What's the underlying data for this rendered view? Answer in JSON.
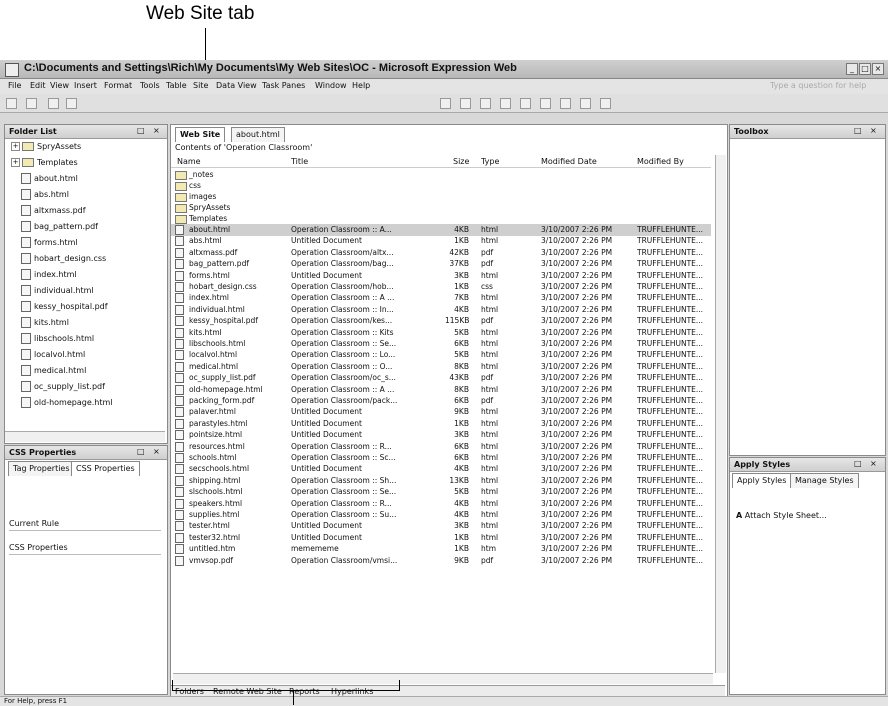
{
  "callouts": {
    "top": "Web Site tab"
  },
  "window": {
    "title": "C:\\Documents and Settings\\Rich\\My Documents\\My Web Sites\\OC - Microsoft Expression Web"
  },
  "menu": [
    "File",
    "Edit",
    "View",
    "Insert",
    "Format",
    "Tools",
    "Table",
    "Site",
    "Data View",
    "Task Panes",
    "Window",
    "Help"
  ],
  "help_box": "Type a question for help",
  "folder_list": {
    "title": "Folder List",
    "items": [
      {
        "label": "SpryAssets",
        "type": "folder",
        "expand": "+"
      },
      {
        "label": "Templates",
        "type": "folder",
        "expand": "+"
      },
      {
        "label": "about.html",
        "type": "file"
      },
      {
        "label": "abs.html",
        "type": "file"
      },
      {
        "label": "altxmass.pdf",
        "type": "file"
      },
      {
        "label": "bag_pattern.pdf",
        "type": "file"
      },
      {
        "label": "forms.html",
        "type": "file"
      },
      {
        "label": "hobart_design.css",
        "type": "file"
      },
      {
        "label": "index.html",
        "type": "file"
      },
      {
        "label": "individual.html",
        "type": "file"
      },
      {
        "label": "kessy_hospital.pdf",
        "type": "file"
      },
      {
        "label": "kits.html",
        "type": "file"
      },
      {
        "label": "libschools.html",
        "type": "file"
      },
      {
        "label": "localvol.html",
        "type": "file"
      },
      {
        "label": "medical.html",
        "type": "file"
      },
      {
        "label": "oc_supply_list.pdf",
        "type": "file"
      },
      {
        "label": "old-homepage.html",
        "type": "file"
      }
    ]
  },
  "css_properties": {
    "title": "CSS Properties",
    "tabs": [
      "Tag Properties",
      "CSS Properties"
    ],
    "current_rule_label": "Current Rule",
    "properties_label": "CSS Properties"
  },
  "editor": {
    "tabs": [
      "Web Site",
      "about.html"
    ],
    "contents_label": "Contents of 'Operation Classroom'",
    "columns": [
      "Name",
      "Title",
      "Size",
      "Type",
      "Modified Date",
      "Modified By"
    ],
    "folders": [
      "_notes",
      "css",
      "images",
      "SpryAssets",
      "Templates"
    ],
    "files": [
      {
        "name": "about.html",
        "title": "Operation Classroom :: A...",
        "size": "4KB",
        "type": "html",
        "date": "3/10/2007 2:26 PM",
        "by": "TRUFFLEHUNTE...",
        "selected": true
      },
      {
        "name": "abs.html",
        "title": "Untitled Document",
        "size": "1KB",
        "type": "html",
        "date": "3/10/2007 2:26 PM",
        "by": "TRUFFLEHUNTE..."
      },
      {
        "name": "altxmass.pdf",
        "title": "Operation Classroom/altx...",
        "size": "42KB",
        "type": "pdf",
        "date": "3/10/2007 2:26 PM",
        "by": "TRUFFLEHUNTE..."
      },
      {
        "name": "bag_pattern.pdf",
        "title": "Operation Classroom/bag...",
        "size": "37KB",
        "type": "pdf",
        "date": "3/10/2007 2:26 PM",
        "by": "TRUFFLEHUNTE..."
      },
      {
        "name": "forms.html",
        "title": "Untitled Document",
        "size": "3KB",
        "type": "html",
        "date": "3/10/2007 2:26 PM",
        "by": "TRUFFLEHUNTE..."
      },
      {
        "name": "hobart_design.css",
        "title": "Operation Classroom/hob...",
        "size": "1KB",
        "type": "css",
        "date": "3/10/2007 2:26 PM",
        "by": "TRUFFLEHUNTE..."
      },
      {
        "name": "index.html",
        "title": "Operation Classroom :: A ...",
        "size": "7KB",
        "type": "html",
        "date": "3/10/2007 2:26 PM",
        "by": "TRUFFLEHUNTE..."
      },
      {
        "name": "individual.html",
        "title": "Operation Classroom :: In...",
        "size": "4KB",
        "type": "html",
        "date": "3/10/2007 2:26 PM",
        "by": "TRUFFLEHUNTE..."
      },
      {
        "name": "kessy_hospital.pdf",
        "title": "Operation Classroom/kes...",
        "size": "115KB",
        "type": "pdf",
        "date": "3/10/2007 2:26 PM",
        "by": "TRUFFLEHUNTE..."
      },
      {
        "name": "kits.html",
        "title": "Operation Classroom :: Kits",
        "size": "5KB",
        "type": "html",
        "date": "3/10/2007 2:26 PM",
        "by": "TRUFFLEHUNTE..."
      },
      {
        "name": "libschools.html",
        "title": "Operation Classroom :: Se...",
        "size": "6KB",
        "type": "html",
        "date": "3/10/2007 2:26 PM",
        "by": "TRUFFLEHUNTE..."
      },
      {
        "name": "localvol.html",
        "title": "Operation Classroom :: Lo...",
        "size": "5KB",
        "type": "html",
        "date": "3/10/2007 2:26 PM",
        "by": "TRUFFLEHUNTE..."
      },
      {
        "name": "medical.html",
        "title": "Operation Classroom :: O...",
        "size": "8KB",
        "type": "html",
        "date": "3/10/2007 2:26 PM",
        "by": "TRUFFLEHUNTE..."
      },
      {
        "name": "oc_supply_list.pdf",
        "title": "Operation Classroom/oc_s...",
        "size": "43KB",
        "type": "pdf",
        "date": "3/10/2007 2:26 PM",
        "by": "TRUFFLEHUNTE..."
      },
      {
        "name": "old-homepage.html",
        "title": "Operation Classroom :: A ...",
        "size": "8KB",
        "type": "html",
        "date": "3/10/2007 2:26 PM",
        "by": "TRUFFLEHUNTE..."
      },
      {
        "name": "packing_form.pdf",
        "title": "Operation Classroom/pack...",
        "size": "6KB",
        "type": "pdf",
        "date": "3/10/2007 2:26 PM",
        "by": "TRUFFLEHUNTE..."
      },
      {
        "name": "palaver.html",
        "title": "Untitled Document",
        "size": "9KB",
        "type": "html",
        "date": "3/10/2007 2:26 PM",
        "by": "TRUFFLEHUNTE..."
      },
      {
        "name": "parastyles.html",
        "title": "Untitled Document",
        "size": "1KB",
        "type": "html",
        "date": "3/10/2007 2:26 PM",
        "by": "TRUFFLEHUNTE..."
      },
      {
        "name": "pointsize.html",
        "title": "Untitled Document",
        "size": "3KB",
        "type": "html",
        "date": "3/10/2007 2:26 PM",
        "by": "TRUFFLEHUNTE..."
      },
      {
        "name": "resources.html",
        "title": "Operation Classroom :: R...",
        "size": "6KB",
        "type": "html",
        "date": "3/10/2007 2:26 PM",
        "by": "TRUFFLEHUNTE..."
      },
      {
        "name": "schools.html",
        "title": "Operation Classroom :: Sc...",
        "size": "6KB",
        "type": "html",
        "date": "3/10/2007 2:26 PM",
        "by": "TRUFFLEHUNTE..."
      },
      {
        "name": "secschools.html",
        "title": "Untitled Document",
        "size": "4KB",
        "type": "html",
        "date": "3/10/2007 2:26 PM",
        "by": "TRUFFLEHUNTE..."
      },
      {
        "name": "shipping.html",
        "title": "Operation Classroom :: Sh...",
        "size": "13KB",
        "type": "html",
        "date": "3/10/2007 2:26 PM",
        "by": "TRUFFLEHUNTE..."
      },
      {
        "name": "slschools.html",
        "title": "Operation Classroom :: Se...",
        "size": "5KB",
        "type": "html",
        "date": "3/10/2007 2:26 PM",
        "by": "TRUFFLEHUNTE..."
      },
      {
        "name": "speakers.html",
        "title": "Operation Classroom :: R...",
        "size": "4KB",
        "type": "html",
        "date": "3/10/2007 2:26 PM",
        "by": "TRUFFLEHUNTE..."
      },
      {
        "name": "supplies.html",
        "title": "Operation Classroom :: Su...",
        "size": "4KB",
        "type": "html",
        "date": "3/10/2007 2:26 PM",
        "by": "TRUFFLEHUNTE..."
      },
      {
        "name": "tester.html",
        "title": "Untitled Document",
        "size": "3KB",
        "type": "html",
        "date": "3/10/2007 2:26 PM",
        "by": "TRUFFLEHUNTE..."
      },
      {
        "name": "tester32.html",
        "title": "Untitled Document",
        "size": "1KB",
        "type": "html",
        "date": "3/10/2007 2:26 PM",
        "by": "TRUFFLEHUNTE..."
      },
      {
        "name": "untitled.htm",
        "title": "memememe",
        "size": "1KB",
        "type": "htm",
        "date": "3/10/2007 2:26 PM",
        "by": "TRUFFLEHUNTE..."
      },
      {
        "name": "vmvsop.pdf",
        "title": "Operation Classroom/vmsi...",
        "size": "9KB",
        "type": "pdf",
        "date": "3/10/2007 2:26 PM",
        "by": "TRUFFLEHUNTE..."
      }
    ],
    "view_tabs": [
      "Folders",
      "Remote Web Site",
      "Reports",
      "Hyperlinks"
    ]
  },
  "toolbox": {
    "title": "Toolbox"
  },
  "apply_styles": {
    "title": "Apply Styles",
    "tabs": [
      "Apply Styles",
      "Manage Styles"
    ],
    "attach": "Attach Style Sheet..."
  },
  "status": "For Help, press F1"
}
